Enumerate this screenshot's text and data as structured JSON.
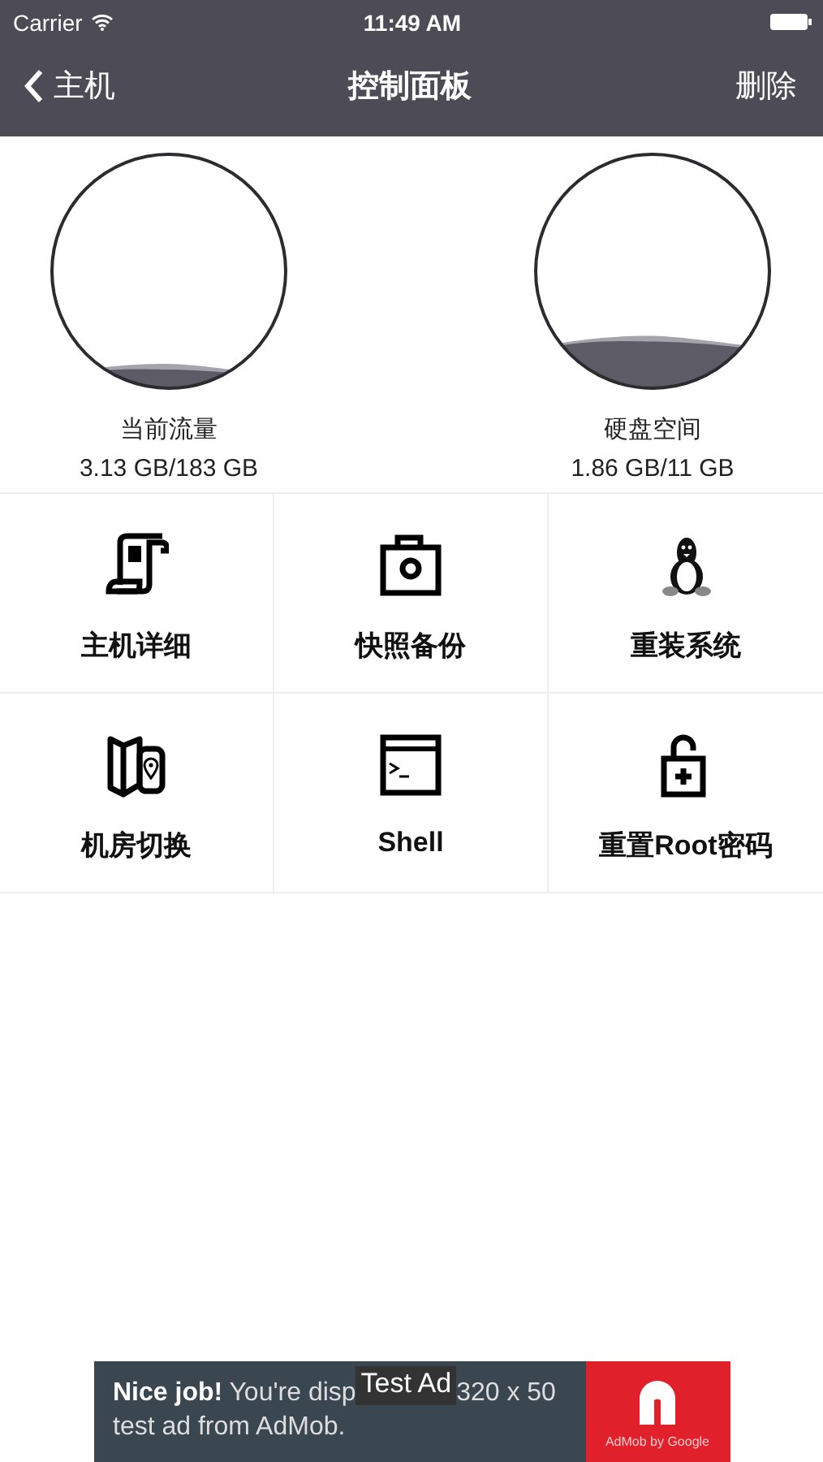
{
  "status_bar": {
    "carrier": "Carrier",
    "time": "11:49 AM"
  },
  "nav": {
    "back": "主机",
    "title": "控制面板",
    "action": "删除"
  },
  "gauges": [
    {
      "label": "当前流量",
      "reading": "3.13 GB/183 GB",
      "level": 0.08
    },
    {
      "label": "硬盘空间",
      "reading": "1.86 GB/11 GB",
      "level": 0.2
    }
  ],
  "tiles": [
    {
      "kind": "scroll",
      "label": "主机详细"
    },
    {
      "kind": "camera",
      "label": "快照备份"
    },
    {
      "kind": "penguin",
      "label": "重装系统"
    },
    {
      "kind": "map",
      "label": "机房切换"
    },
    {
      "kind": "terminal",
      "label": "Shell"
    },
    {
      "kind": "unlock",
      "label": "重置Root密码"
    }
  ],
  "ad": {
    "line_1_start": "**Nice job!** You're disp",
    "line_1_end": "320 x 50",
    "line_2": "test ad from AdMob.",
    "badge": "Test Ad",
    "logo_caption": "AdMob by Google"
  }
}
